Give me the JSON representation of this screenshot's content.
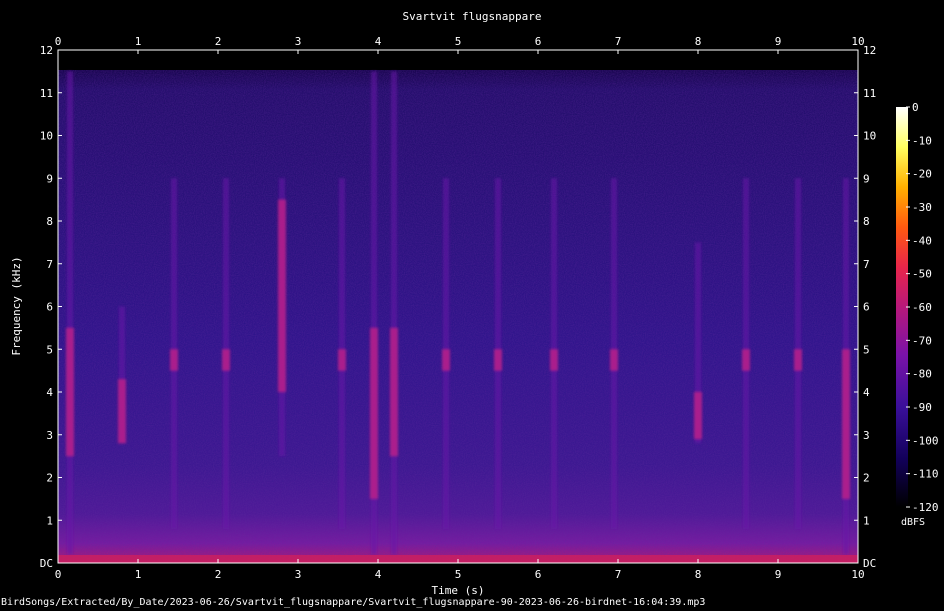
{
  "chart_data": {
    "type": "heatmap",
    "title": "Svartvit flugsnappare",
    "xlabel": "Time (s)",
    "ylabel": "Frequency (kHz)",
    "xlim": [
      0,
      10
    ],
    "ylim": [
      0,
      12
    ],
    "x_ticks": [
      "0",
      "1",
      "2",
      "3",
      "4",
      "5",
      "6",
      "7",
      "8",
      "9",
      "10"
    ],
    "y_ticks": [
      "DC",
      "1",
      "2",
      "3",
      "4",
      "5",
      "6",
      "7",
      "8",
      "9",
      "10",
      "11",
      "12"
    ],
    "colorbar": {
      "label": "dBFS",
      "range": [
        -120,
        0
      ],
      "ticks": [
        "0",
        "-10",
        "-20",
        "-30",
        "-40",
        "-50",
        "-60",
        "-70",
        "-80",
        "-90",
        "-100",
        "-110",
        "-120"
      ],
      "colors": [
        "#000000",
        "#12005a",
        "#3a0f9a",
        "#7a12a8",
        "#b8187a",
        "#e8254a",
        "#ff5a10",
        "#ffb000",
        "#ffff60",
        "#ffffff"
      ]
    },
    "background_level_dbfs": -95,
    "notable_events": [
      {
        "t": 0.15,
        "f_low": 0.2,
        "f_high": 11.5,
        "peak_band_khz": [
          2.5,
          5.5
        ]
      },
      {
        "t": 0.8,
        "f_low": 2.8,
        "f_high": 6.0,
        "peak_band_khz": [
          2.8,
          4.3
        ]
      },
      {
        "t": 1.45,
        "f_low": 0.8,
        "f_high": 9.0,
        "peak_band_khz": [
          4.5,
          5.0
        ]
      },
      {
        "t": 2.1,
        "f_low": 0.8,
        "f_high": 9.0,
        "peak_band_khz": [
          4.5,
          5.0
        ]
      },
      {
        "t": 2.8,
        "f_low": 2.5,
        "f_high": 9.0,
        "peak_band_khz": [
          4.0,
          8.5
        ]
      },
      {
        "t": 3.55,
        "f_low": 0.8,
        "f_high": 9.0,
        "peak_band_khz": [
          4.5,
          5.0
        ]
      },
      {
        "t": 3.95,
        "f_low": 0.2,
        "f_high": 11.5,
        "peak_band_khz": [
          1.5,
          5.5
        ]
      },
      {
        "t": 4.2,
        "f_low": 0.2,
        "f_high": 11.5,
        "peak_band_khz": [
          2.5,
          5.5
        ]
      },
      {
        "t": 4.85,
        "f_low": 0.8,
        "f_high": 9.0,
        "peak_band_khz": [
          4.5,
          5.0
        ]
      },
      {
        "t": 5.5,
        "f_low": 0.8,
        "f_high": 9.0,
        "peak_band_khz": [
          4.5,
          5.0
        ]
      },
      {
        "t": 6.2,
        "f_low": 0.8,
        "f_high": 9.0,
        "peak_band_khz": [
          4.5,
          5.0
        ]
      },
      {
        "t": 6.95,
        "f_low": 0.8,
        "f_high": 9.0,
        "peak_band_khz": [
          4.5,
          5.0
        ]
      },
      {
        "t": 8.0,
        "f_low": 2.8,
        "f_high": 7.5,
        "peak_band_khz": [
          2.9,
          4.0
        ]
      },
      {
        "t": 8.6,
        "f_low": 0.8,
        "f_high": 9.0,
        "peak_band_khz": [
          4.5,
          5.0
        ]
      },
      {
        "t": 9.25,
        "f_low": 0.8,
        "f_high": 9.0,
        "peak_band_khz": [
          4.5,
          5.0
        ]
      },
      {
        "t": 9.85,
        "f_low": 0.2,
        "f_high": 9.0,
        "peak_band_khz": [
          1.5,
          5.0
        ]
      }
    ]
  },
  "footer_path": "BirdSongs/Extracted/By_Date/2023-06-26/Svartvit_flugsnappare/Svartvit_flugsnappare-90-2023-06-26-birdnet-16:04:39.mp3"
}
